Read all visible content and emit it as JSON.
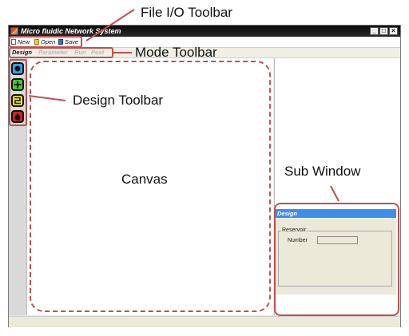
{
  "window": {
    "title": "Micro fluidic Network System",
    "caption_buttons": [
      "_",
      "□",
      "×"
    ]
  },
  "file_toolbar": {
    "items": [
      {
        "label": "New",
        "icon": "new-file-icon"
      },
      {
        "label": "Open",
        "icon": "open-folder-icon"
      },
      {
        "label": "Save",
        "icon": "save-disk-icon"
      }
    ]
  },
  "mode_toolbar": {
    "tabs": [
      "Design",
      "Parameter",
      "Run",
      "Post"
    ],
    "active": "Design"
  },
  "design_toolbar": {
    "tools": [
      {
        "icon": "reservoir-tool-icon",
        "color": "#2aa7e8"
      },
      {
        "icon": "add-tool-icon",
        "color": "#3ecf2a"
      },
      {
        "icon": "channel-tool-icon",
        "color": "#f2e21a"
      },
      {
        "icon": "drop-tool-icon",
        "color": "#d42020"
      }
    ]
  },
  "sub_window": {
    "header": "Design",
    "group_label": "Reservoir",
    "field_label": "Number",
    "field_value": ""
  },
  "annotations": {
    "file_io": "File I/O Toolbar",
    "mode": "Mode Toolbar",
    "design": "Design Toolbar",
    "canvas": "Canvas",
    "sub_window": "Sub Window",
    "color": "#c0504d"
  }
}
